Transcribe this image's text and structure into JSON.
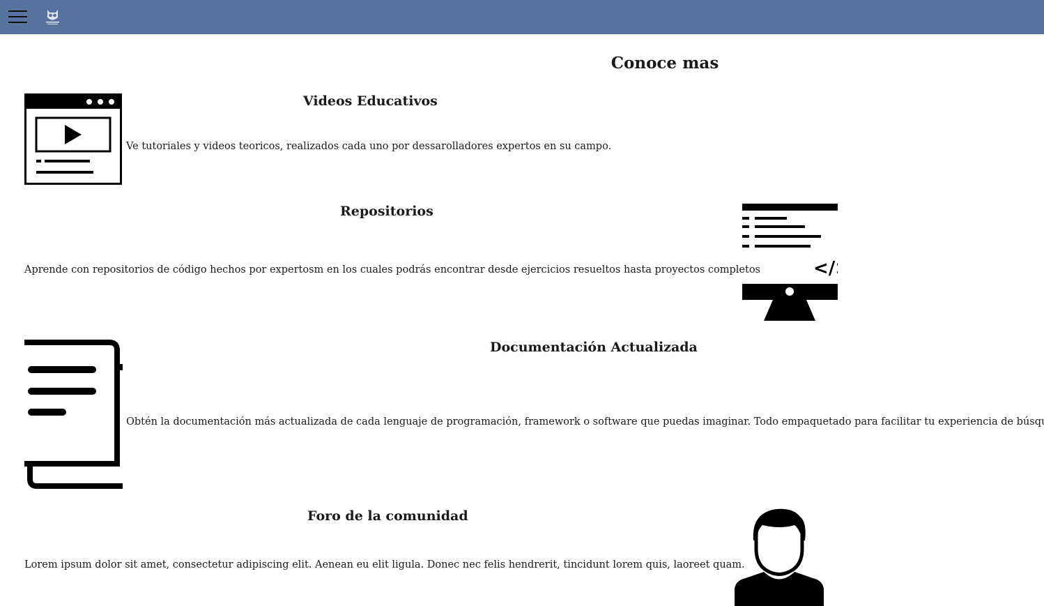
{
  "nav": {
    "menu_icon": "hamburger-menu-icon",
    "logo_icon": "owl-logo-icon",
    "bar_color": "#5873a0"
  },
  "main": {
    "title": "Conoce mas",
    "features": [
      {
        "title": "Videos Educativos",
        "text": "Ve tutoriales y videos teoricos, realizados cada uno por dessarolladores expertos en su campo.",
        "icon": "video-player-icon"
      },
      {
        "title": "Repositorios",
        "text": "Aprende con repositorios de código hechos por expertosm en los cuales podrás encontrar desde ejercicios resueltos hasta proyectos completos",
        "icon": "code-monitor-icon"
      },
      {
        "title": "Documentación Actualizada",
        "text": "Obtén la documentación más actualizada de cada lenguaje de programación, framework o software que puedas imaginar. Todo empaquetado para facilitar tu experiencia de búsquda.",
        "icon": "book-icon"
      },
      {
        "title": "Foro de la comunidad",
        "text": "Lorem ipsum dolor sit amet, consectetur adipiscing elit. Aenean eu elit ligula. Donec nec felis hendrerit, tincidunt lorem quis, laoreet quam.",
        "icon": "user-avatar-icon"
      }
    ]
  }
}
